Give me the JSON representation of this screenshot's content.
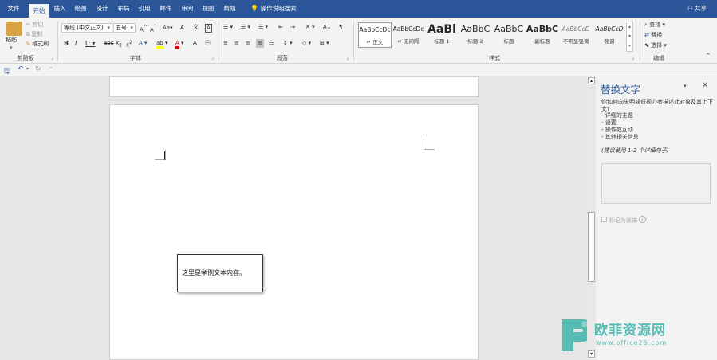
{
  "tabs": [
    "文件",
    "开始",
    "插入",
    "绘图",
    "设计",
    "布局",
    "引用",
    "邮件",
    "审阅",
    "视图",
    "帮助"
  ],
  "active_tab": "开始",
  "tell_me": "操作说明搜索",
  "share": "共享",
  "clipboard": {
    "paste": "粘贴",
    "cut": "剪切",
    "copy": "复制",
    "format_painter": "格式刷",
    "label": "剪贴板"
  },
  "font": {
    "name": "等线 (中文正文)",
    "size": "五号",
    "label": "字体"
  },
  "paragraph": {
    "label": "段落"
  },
  "styles": {
    "label": "样式",
    "items": [
      {
        "preview": "AaBbCcDc",
        "name": "↵ 正文"
      },
      {
        "preview": "AaBbCcDc",
        "name": "↵ 无间隔"
      },
      {
        "preview": "AaBl",
        "name": "标题 1"
      },
      {
        "preview": "AaBbC",
        "name": "标题 2"
      },
      {
        "preview": "AaBbC",
        "name": "标题"
      },
      {
        "preview": "AaBbC",
        "name": "副标题"
      },
      {
        "preview": "AaBbCcD",
        "name": "不明显强调"
      },
      {
        "preview": "AaBbCcD",
        "name": "强调"
      }
    ]
  },
  "editing": {
    "find": "查找",
    "replace": "替换",
    "select": "选择",
    "label": "编辑"
  },
  "document": {
    "text_box_text": "这里是举例文本内容。"
  },
  "alt_text_pane": {
    "title": "替换文字",
    "description": "你如何向失明或低视力者描述此对象及其上下文?",
    "bullets": [
      "- 详细的主题",
      "- 设置",
      "- 操作或互动",
      "- 其他相关信息"
    ],
    "hint": "(建议使用 1-2 个详细句子)",
    "input_value": "",
    "decorative_label": "标记为装饰"
  },
  "watermark": {
    "brand": "欧菲资源网",
    "url": "www.office26.com"
  },
  "colors": {
    "ribbon_blue": "#2b579a",
    "highlight_yellow": "#ffff00",
    "font_red": "#e00000",
    "watermark_teal": "#3bb3a9"
  }
}
